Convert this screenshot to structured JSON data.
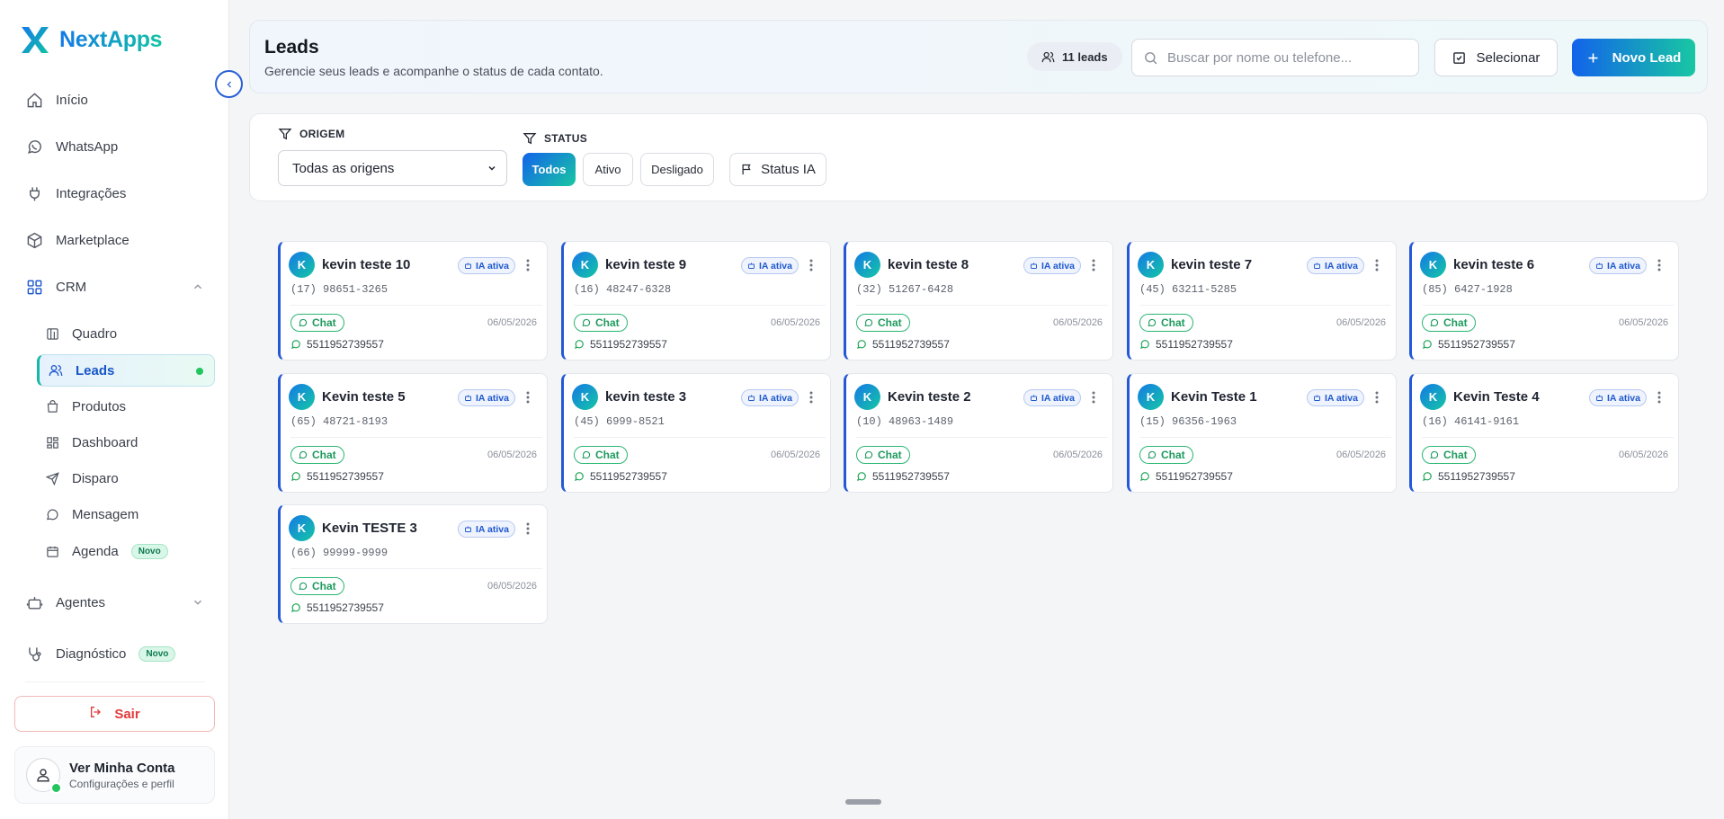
{
  "app": {
    "name": "NextApps"
  },
  "sidebar": {
    "items": [
      {
        "label": "Início",
        "icon": "home-icon"
      },
      {
        "label": "WhatsApp",
        "icon": "whatsapp-icon"
      },
      {
        "label": "Integrações",
        "icon": "plug-icon"
      },
      {
        "label": "Marketplace",
        "icon": "box-icon"
      },
      {
        "label": "CRM",
        "icon": "grid-icon"
      }
    ],
    "crm_sub": [
      {
        "label": "Quadro",
        "icon": "board-icon"
      },
      {
        "label": "Leads",
        "icon": "users-icon",
        "active": true
      },
      {
        "label": "Produtos",
        "icon": "bag-icon"
      },
      {
        "label": "Dashboard",
        "icon": "dashboard-icon"
      },
      {
        "label": "Disparo",
        "icon": "send-icon"
      },
      {
        "label": "Mensagem",
        "icon": "message-icon"
      },
      {
        "label": "Agenda",
        "icon": "calendar-icon",
        "badge": "Novo"
      }
    ],
    "agentes_label": "Agentes",
    "diagnostico_label": "Diagnóstico",
    "diagnostico_badge": "Novo",
    "logout_label": "Sair",
    "account_name": "Ver Minha Conta",
    "account_sub": "Configurações e perfil"
  },
  "header": {
    "title": "Leads",
    "subtitle": "Gerencie seus leads e acompanhe o status de cada contato.",
    "count_label": "11 leads",
    "search_placeholder": "Buscar por nome ou telefone...",
    "select_label": "Selecionar",
    "new_label": "Novo Lead"
  },
  "filters": {
    "origin_label": "ORIGEM",
    "origin_value": "Todas as origens",
    "status_label": "STATUS",
    "status_options": [
      "Todos",
      "Ativo",
      "Desligado"
    ],
    "status_active": "Todos",
    "status_ia_label": "Status IA"
  },
  "leads": [
    {
      "initial": "K",
      "name": "kevin teste 10",
      "phone": "(17) 98651-3265",
      "ia": "IA ativa",
      "tag": "Chat",
      "date": "06/05/2026",
      "whatsapp": "5511952739557"
    },
    {
      "initial": "K",
      "name": "kevin teste 9",
      "phone": "(16) 48247-6328",
      "ia": "IA ativa",
      "tag": "Chat",
      "date": "06/05/2026",
      "whatsapp": "5511952739557"
    },
    {
      "initial": "K",
      "name": "kevin teste 8",
      "phone": "(32) 51267-6428",
      "ia": "IA ativa",
      "tag": "Chat",
      "date": "06/05/2026",
      "whatsapp": "5511952739557"
    },
    {
      "initial": "K",
      "name": "kevin teste 7",
      "phone": "(45) 63211-5285",
      "ia": "IA ativa",
      "tag": "Chat",
      "date": "06/05/2026",
      "whatsapp": "5511952739557"
    },
    {
      "initial": "K",
      "name": "kevin teste 6",
      "phone": "(85) 6427-1928",
      "ia": "IA ativa",
      "tag": "Chat",
      "date": "06/05/2026",
      "whatsapp": "5511952739557"
    },
    {
      "initial": "K",
      "name": "Kevin teste 5",
      "phone": "(65) 48721-8193",
      "ia": "IA ativa",
      "tag": "Chat",
      "date": "06/05/2026",
      "whatsapp": "5511952739557"
    },
    {
      "initial": "K",
      "name": "kevin teste 3",
      "phone": "(45) 6999-8521",
      "ia": "IA ativa",
      "tag": "Chat",
      "date": "06/05/2026",
      "whatsapp": "5511952739557"
    },
    {
      "initial": "K",
      "name": "Kevin teste 2",
      "phone": "(10) 48963-1489",
      "ia": "IA ativa",
      "tag": "Chat",
      "date": "06/05/2026",
      "whatsapp": "5511952739557"
    },
    {
      "initial": "K",
      "name": "Kevin Teste 1",
      "phone": "(15) 96356-1963",
      "ia": "IA ativa",
      "tag": "Chat",
      "date": "06/05/2026",
      "whatsapp": "5511952739557"
    },
    {
      "initial": "K",
      "name": "Kevin Teste 4",
      "phone": "(16) 46141-9161",
      "ia": "IA ativa",
      "tag": "Chat",
      "date": "06/05/2026",
      "whatsapp": "5511952739557"
    },
    {
      "initial": "K",
      "name": "Kevin TESTE 3",
      "phone": "(66) 99999-9999",
      "ia": "IA ativa",
      "tag": "Chat",
      "date": "06/05/2026",
      "whatsapp": "5511952739557"
    }
  ],
  "colors": {
    "primary": "#1263ea",
    "accent": "#18c7a3",
    "card_border": "#2458d6",
    "chat_green": "#2bb673",
    "danger": "#e23b3b"
  }
}
